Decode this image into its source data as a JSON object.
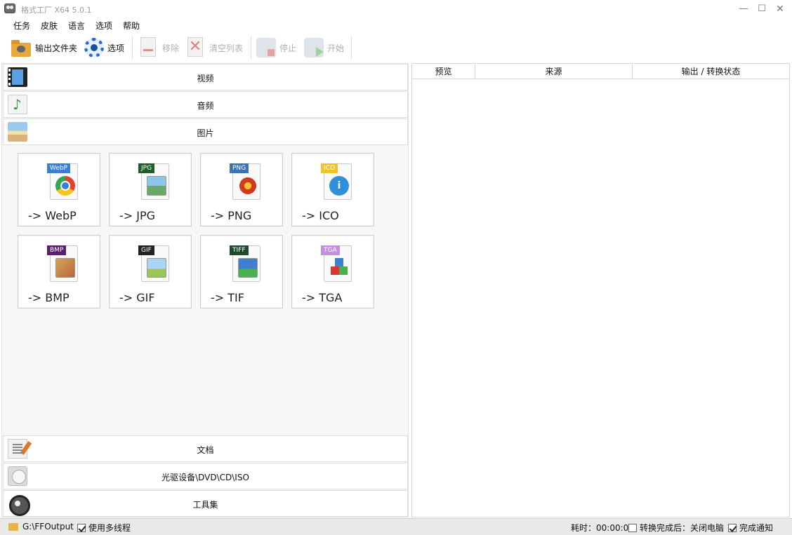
{
  "window": {
    "title": "格式工厂 X64 5.0.1",
    "minimize_glyph": "—",
    "maximize_glyph": "☐",
    "close_glyph": "✕"
  },
  "menu": [
    "任务",
    "皮肤",
    "语言",
    "选项",
    "帮助"
  ],
  "toolbar": {
    "output_folder": "输出文件夹",
    "options": "选项",
    "remove": "移除",
    "clear_list": "清空列表",
    "stop": "停止",
    "start": "开始"
  },
  "categories": {
    "video": "视频",
    "audio": "音频",
    "image": "图片",
    "document": "文档",
    "optical": "光驱设备\\DVD\\CD\\ISO",
    "tools": "工具集"
  },
  "image_formats": [
    {
      "tag": "WebP",
      "label": "-> WebP",
      "color": "#3b7fd4"
    },
    {
      "tag": "JPG",
      "label": "-> JPG",
      "color": "#1f5e2a"
    },
    {
      "tag": "PNG",
      "label": "-> PNG",
      "color": "#3a74b8"
    },
    {
      "tag": "ICO",
      "label": "-> ICO",
      "color": "#f2c22b"
    },
    {
      "tag": "BMP",
      "label": "-> BMP",
      "color": "#5a1e6e"
    },
    {
      "tag": "GIF",
      "label": "-> GIF",
      "color": "#222222"
    },
    {
      "tag": "TIFF",
      "label": "-> TIF",
      "color": "#1d4a2a"
    },
    {
      "tag": "TGA",
      "label": "-> TGA",
      "color": "#c58ee0"
    }
  ],
  "task_table": {
    "columns": [
      "预览",
      "来源",
      "输出 / 转换状态"
    ]
  },
  "status": {
    "output_path": "G:\\FFOutput",
    "multithread": "使用多线程",
    "elapsed": "耗时：00:00:00",
    "after_complete": "转换完成后：关闭电脑",
    "notify": "完成通知"
  }
}
